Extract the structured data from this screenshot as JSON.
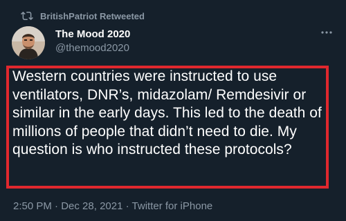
{
  "retweet": {
    "icon": "retweet-icon",
    "label": "BritishPatriot Retweeted"
  },
  "author": {
    "display_name": "The Mood 2020",
    "handle": "@themood2020",
    "avatar_icon": "avatar"
  },
  "tweet": {
    "text": "Western countries were instructed to use ventilators, DNR’s, midazolam/ Remdesivir or similar in the early days. This led to the death of millions of people that didn’t need to die. My question is who instructed these protocols?",
    "time": "2:50 PM",
    "separator1": "·",
    "date": "Dec 28, 2021",
    "separator2": "·",
    "source": "Twitter for iPhone"
  },
  "colors": {
    "background": "#15202b",
    "muted": "#8b98a5",
    "highlight_border": "#e0282e"
  }
}
